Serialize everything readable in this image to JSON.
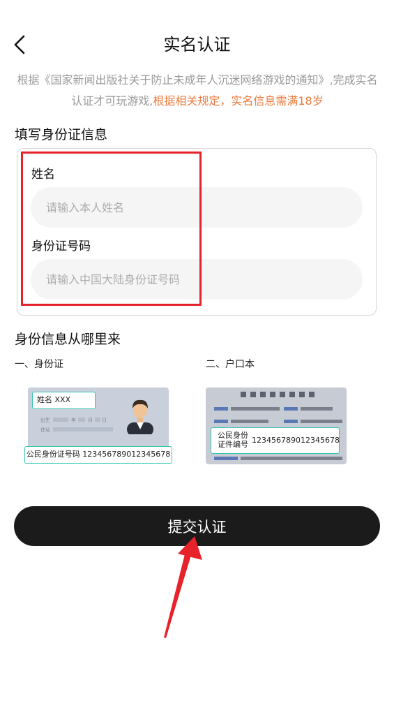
{
  "header": {
    "title": "实名认证",
    "back_icon": "chevron-left-icon"
  },
  "notice": {
    "text": "根据《国家新闻出版社关于防止未成年人沉迷网络游戏的通知》,完成实名认证才可玩游戏,",
    "highlight": "根据相关规定，实名信息需满18岁",
    "highlight_color": "#ea7a3d"
  },
  "form": {
    "section_title": "填写身份证信息",
    "name_label": "姓名",
    "name_placeholder": "请输入本人姓名",
    "name_value": "",
    "id_label": "身份证号码",
    "id_placeholder": "请输入中国大陆身份证号码",
    "id_value": "",
    "highlight_box_color": "#e8222a"
  },
  "info": {
    "section_title": "身份信息从哪里来",
    "id_card": {
      "caption": "一、身份证",
      "name_tag": "姓名 XXX",
      "number_tag": "公民身份证号码 123456789012345678",
      "field_birth": "出生",
      "field_address": "住址",
      "field_year": "年",
      "field_month": "月",
      "field_day": "日"
    },
    "hukou": {
      "caption": "二、户口本",
      "label_line1": "公民身份",
      "label_line2": "证件编号",
      "number": "123456789012345678"
    }
  },
  "submit": {
    "label": "提交认证"
  },
  "annotation": {
    "arrow_color": "#e8222a"
  }
}
